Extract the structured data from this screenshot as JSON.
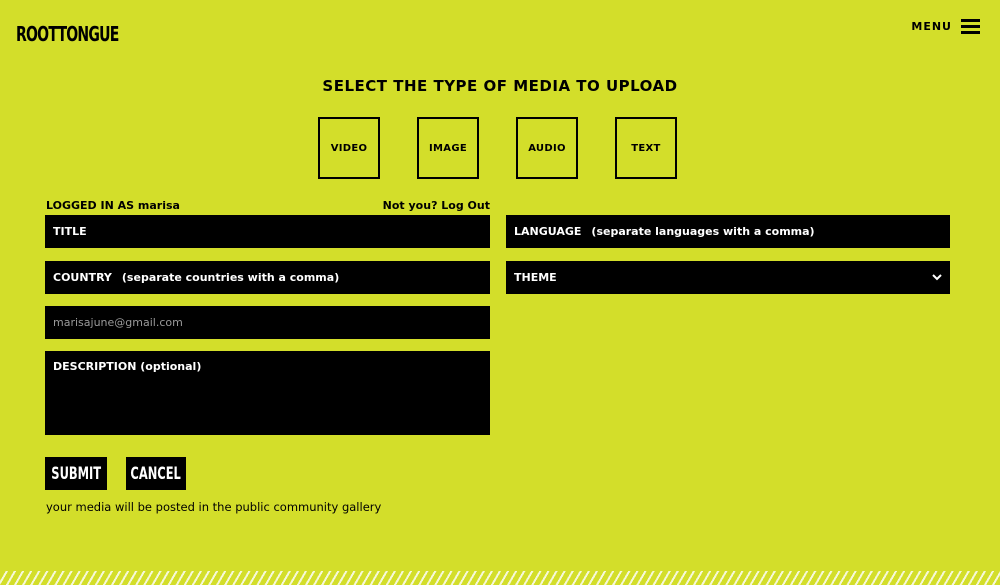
{
  "header": {
    "logo": "ROOTTONGUE",
    "menu_label": "MENU"
  },
  "heading": "SELECT THE TYPE OF MEDIA TO UPLOAD",
  "media_types": [
    "VIDEO",
    "IMAGE",
    "AUDIO",
    "TEXT"
  ],
  "user": {
    "logged_in_text": "LOGGED IN AS marisa",
    "logout_text": "Not you? Log Out"
  },
  "form": {
    "title_label": "TITLE",
    "language_label": "LANGUAGE",
    "language_hint": "(separate languages with a comma)",
    "country_label": "COUNTRY",
    "country_hint": "(separate countries with a comma)",
    "theme_label": "THEME",
    "email_value": "marisajune@gmail.com",
    "description_label": "DESCRIPTION (optional)"
  },
  "buttons": {
    "submit": "SUBMIT",
    "cancel": "CANCEL"
  },
  "note": "your media will be posted in the public community gallery",
  "colors": {
    "background": "#d3de2a",
    "field": "#000000",
    "field_text": "#ffffff"
  }
}
